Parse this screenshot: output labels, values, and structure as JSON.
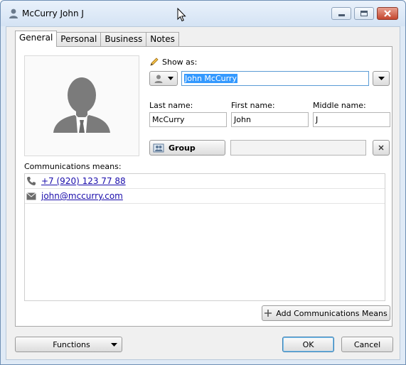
{
  "window": {
    "title": "McCurry John J"
  },
  "tabs": [
    "General",
    "Personal",
    "Business",
    "Notes"
  ],
  "general": {
    "show_as_label": "Show as:",
    "show_as_value": "John McCurry",
    "last_name_label": "Last name:",
    "last_name_value": "McCurry",
    "first_name_label": "First name:",
    "first_name_value": "John",
    "middle_name_label": "Middle name:",
    "middle_name_value": "J",
    "group_button_label": "Group",
    "group_value": "",
    "comm_label": "Communications means:",
    "comm_items": [
      {
        "icon": "phone-icon",
        "value": "+7 (920) 123 77 88"
      },
      {
        "icon": "envelope-icon",
        "value": "john@mccurry.com"
      }
    ],
    "add_comm_label": "Add Communications Means"
  },
  "footer": {
    "functions_label": "Functions",
    "ok_label": "OK",
    "cancel_label": "Cancel"
  },
  "colors": {
    "selection": "#3399ff",
    "link": "#1a0dab",
    "window_frame": "#dfeaf6"
  }
}
